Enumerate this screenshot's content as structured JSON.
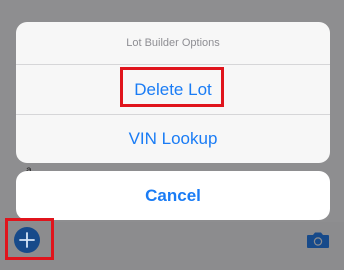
{
  "action_sheet": {
    "title": "Lot Builder Options",
    "actions": [
      {
        "label": "Delete Lot"
      },
      {
        "label": "VIN Lookup"
      }
    ],
    "cancel_label": "Cancel"
  },
  "toolbar": {
    "left_icon": "plus-circle-icon",
    "right_icon": "camera-icon"
  },
  "colors": {
    "action_blue": "#1a7cf5",
    "highlight_red": "#e0141c",
    "add_button_navy": "#174a8a"
  }
}
